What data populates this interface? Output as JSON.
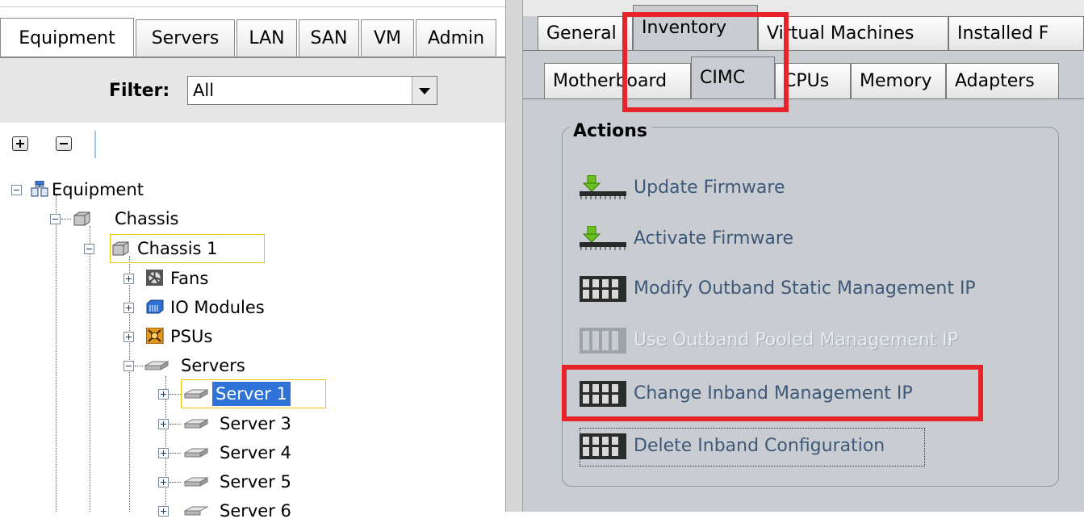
{
  "left_panel": {
    "tabs": [
      "Equipment",
      "Servers",
      "LAN",
      "SAN",
      "VM",
      "Admin"
    ],
    "active_tab": "Equipment",
    "filter": {
      "label": "Filter:",
      "value": "All"
    },
    "tree": {
      "root": "Equipment",
      "chassis_group": "Chassis",
      "chassis": "Chassis 1",
      "children": [
        "Fans",
        "IO Modules",
        "PSUs"
      ],
      "servers_group": "Servers",
      "servers": [
        "Server 1",
        "Server 3",
        "Server 4",
        "Server 5",
        "Server 6"
      ],
      "selected": "Server 1"
    }
  },
  "right_panel": {
    "main_tabs": [
      "General",
      "Inventory",
      "Virtual Machines",
      "Installed F"
    ],
    "active_main_tab": "Inventory",
    "sub_tabs": [
      "Motherboard",
      "CIMC",
      "CPUs",
      "Memory",
      "Adapters"
    ],
    "active_sub_tab": "CIMC",
    "actions_title": "Actions",
    "actions": [
      {
        "label": "Update Firmware",
        "icon": "download-firmware-icon",
        "enabled": true
      },
      {
        "label": "Activate Firmware",
        "icon": "download-firmware-icon",
        "enabled": true
      },
      {
        "label": "Modify Outband Static Management IP",
        "icon": "server-rack-icon",
        "enabled": true
      },
      {
        "label": "Use Outband Pooled Management IP",
        "icon": "server-rack-icon",
        "enabled": false
      },
      {
        "label": "Change Inband Management IP",
        "icon": "server-rack-icon",
        "enabled": true
      },
      {
        "label": "Delete Inband Configuration",
        "icon": "server-rack-icon",
        "enabled": true
      }
    ]
  },
  "colors": {
    "highlight": "#e8242a",
    "selection": "#2f73d6",
    "action_text": "#3d5878"
  }
}
